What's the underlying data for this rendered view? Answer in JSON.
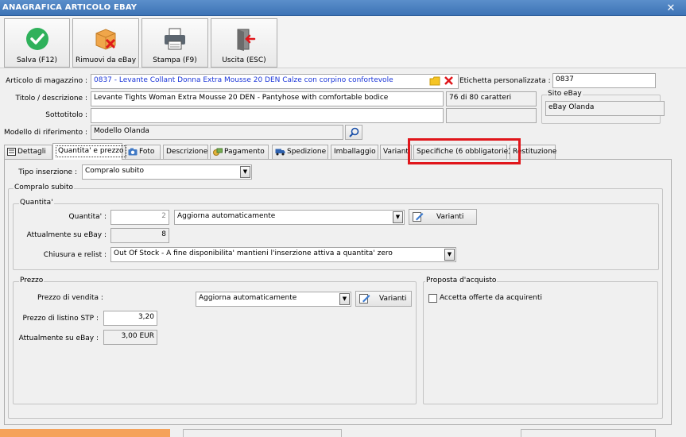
{
  "window": {
    "title": "ANAGRAFICA ARTICOLO EBAY",
    "close_glyph": "✕"
  },
  "toolbar": {
    "buttons": [
      {
        "label": "Salva (F12)",
        "icon": "check-circle-icon"
      },
      {
        "label": "Rimuovi da eBay",
        "icon": "box-remove-icon"
      },
      {
        "label": "Stampa (F9)",
        "icon": "printer-icon"
      },
      {
        "label": "Uscita (ESC)",
        "icon": "exit-door-icon"
      }
    ]
  },
  "header": {
    "articolo_label": "Articolo di magazzino :",
    "articolo_value": "0837 - Levante Collant Donna Extra Mousse 20 DEN Calze con corpino confortevole",
    "etichetta_label": "Etichetta personalizzata :",
    "etichetta_value": "0837",
    "titolo_label": "Titolo / descrizione :",
    "titolo_value": "Levante Tights Woman Extra Mousse 20 DEN - Pantyhose with comfortable bodice",
    "char_count": "76 di 80 caratteri",
    "sottotitolo_label": "Sottotitolo :",
    "sottotitolo_value": "",
    "modello_label": "Modello di riferimento :",
    "modello_value": "Modello Olanda",
    "sito_group": "Sito eBay",
    "sito_value": "eBay Olanda"
  },
  "tabs": [
    {
      "label": "Dettagli",
      "icon": "details-icon"
    },
    {
      "label": "Quantita' e prezzo",
      "active": true
    },
    {
      "label": "Foto",
      "icon": "camera-icon"
    },
    {
      "label": "Descrizione"
    },
    {
      "label": "Pagamento",
      "icon": "payment-icon"
    },
    {
      "label": "Spedizione",
      "icon": "truck-icon"
    },
    {
      "label": "Imballaggio"
    },
    {
      "label": "Varianti"
    },
    {
      "label": "Specifiche (6 obbligatorie)"
    },
    {
      "label": "Restituzione"
    }
  ],
  "panel": {
    "tipo_label": "Tipo inserzione :",
    "tipo_value": "Compralo subito",
    "compralo_group": "Compralo subito",
    "quantita_group": "Quantita'",
    "quantita_label": "Quantita' :",
    "quantita_value": "2",
    "quantita_mode": "Aggiorna automaticamente",
    "varianti_btn": "Varianti",
    "attuale_label": "Attualmente su eBay :",
    "attuale_value": "8",
    "chiusura_label": "Chiusura e relist :",
    "chiusura_value": "Out Of Stock - A fine disponibilita' mantieni l'inserzione attiva a quantita' zero",
    "prezzo_group": "Prezzo",
    "prezzo_vendita_label": "Prezzo di vendita :",
    "prezzo_mode": "Aggiorna automaticamente",
    "varianti_btn2": "Varianti",
    "listino_label": "Prezzo di listino STP :",
    "listino_value": "3,20",
    "attuale_prezzo_label": "Attualmente su eBay :",
    "attuale_prezzo_value": "3,00 EUR",
    "proposta_group": "Proposta d'acquisto",
    "accetta_label": "Accetta offerte da acquirenti",
    "accetta_checked": false
  },
  "colors": {
    "highlight": "#e0161b",
    "link_blue": "#1a35d8",
    "titlebar": "#3d73b5"
  }
}
